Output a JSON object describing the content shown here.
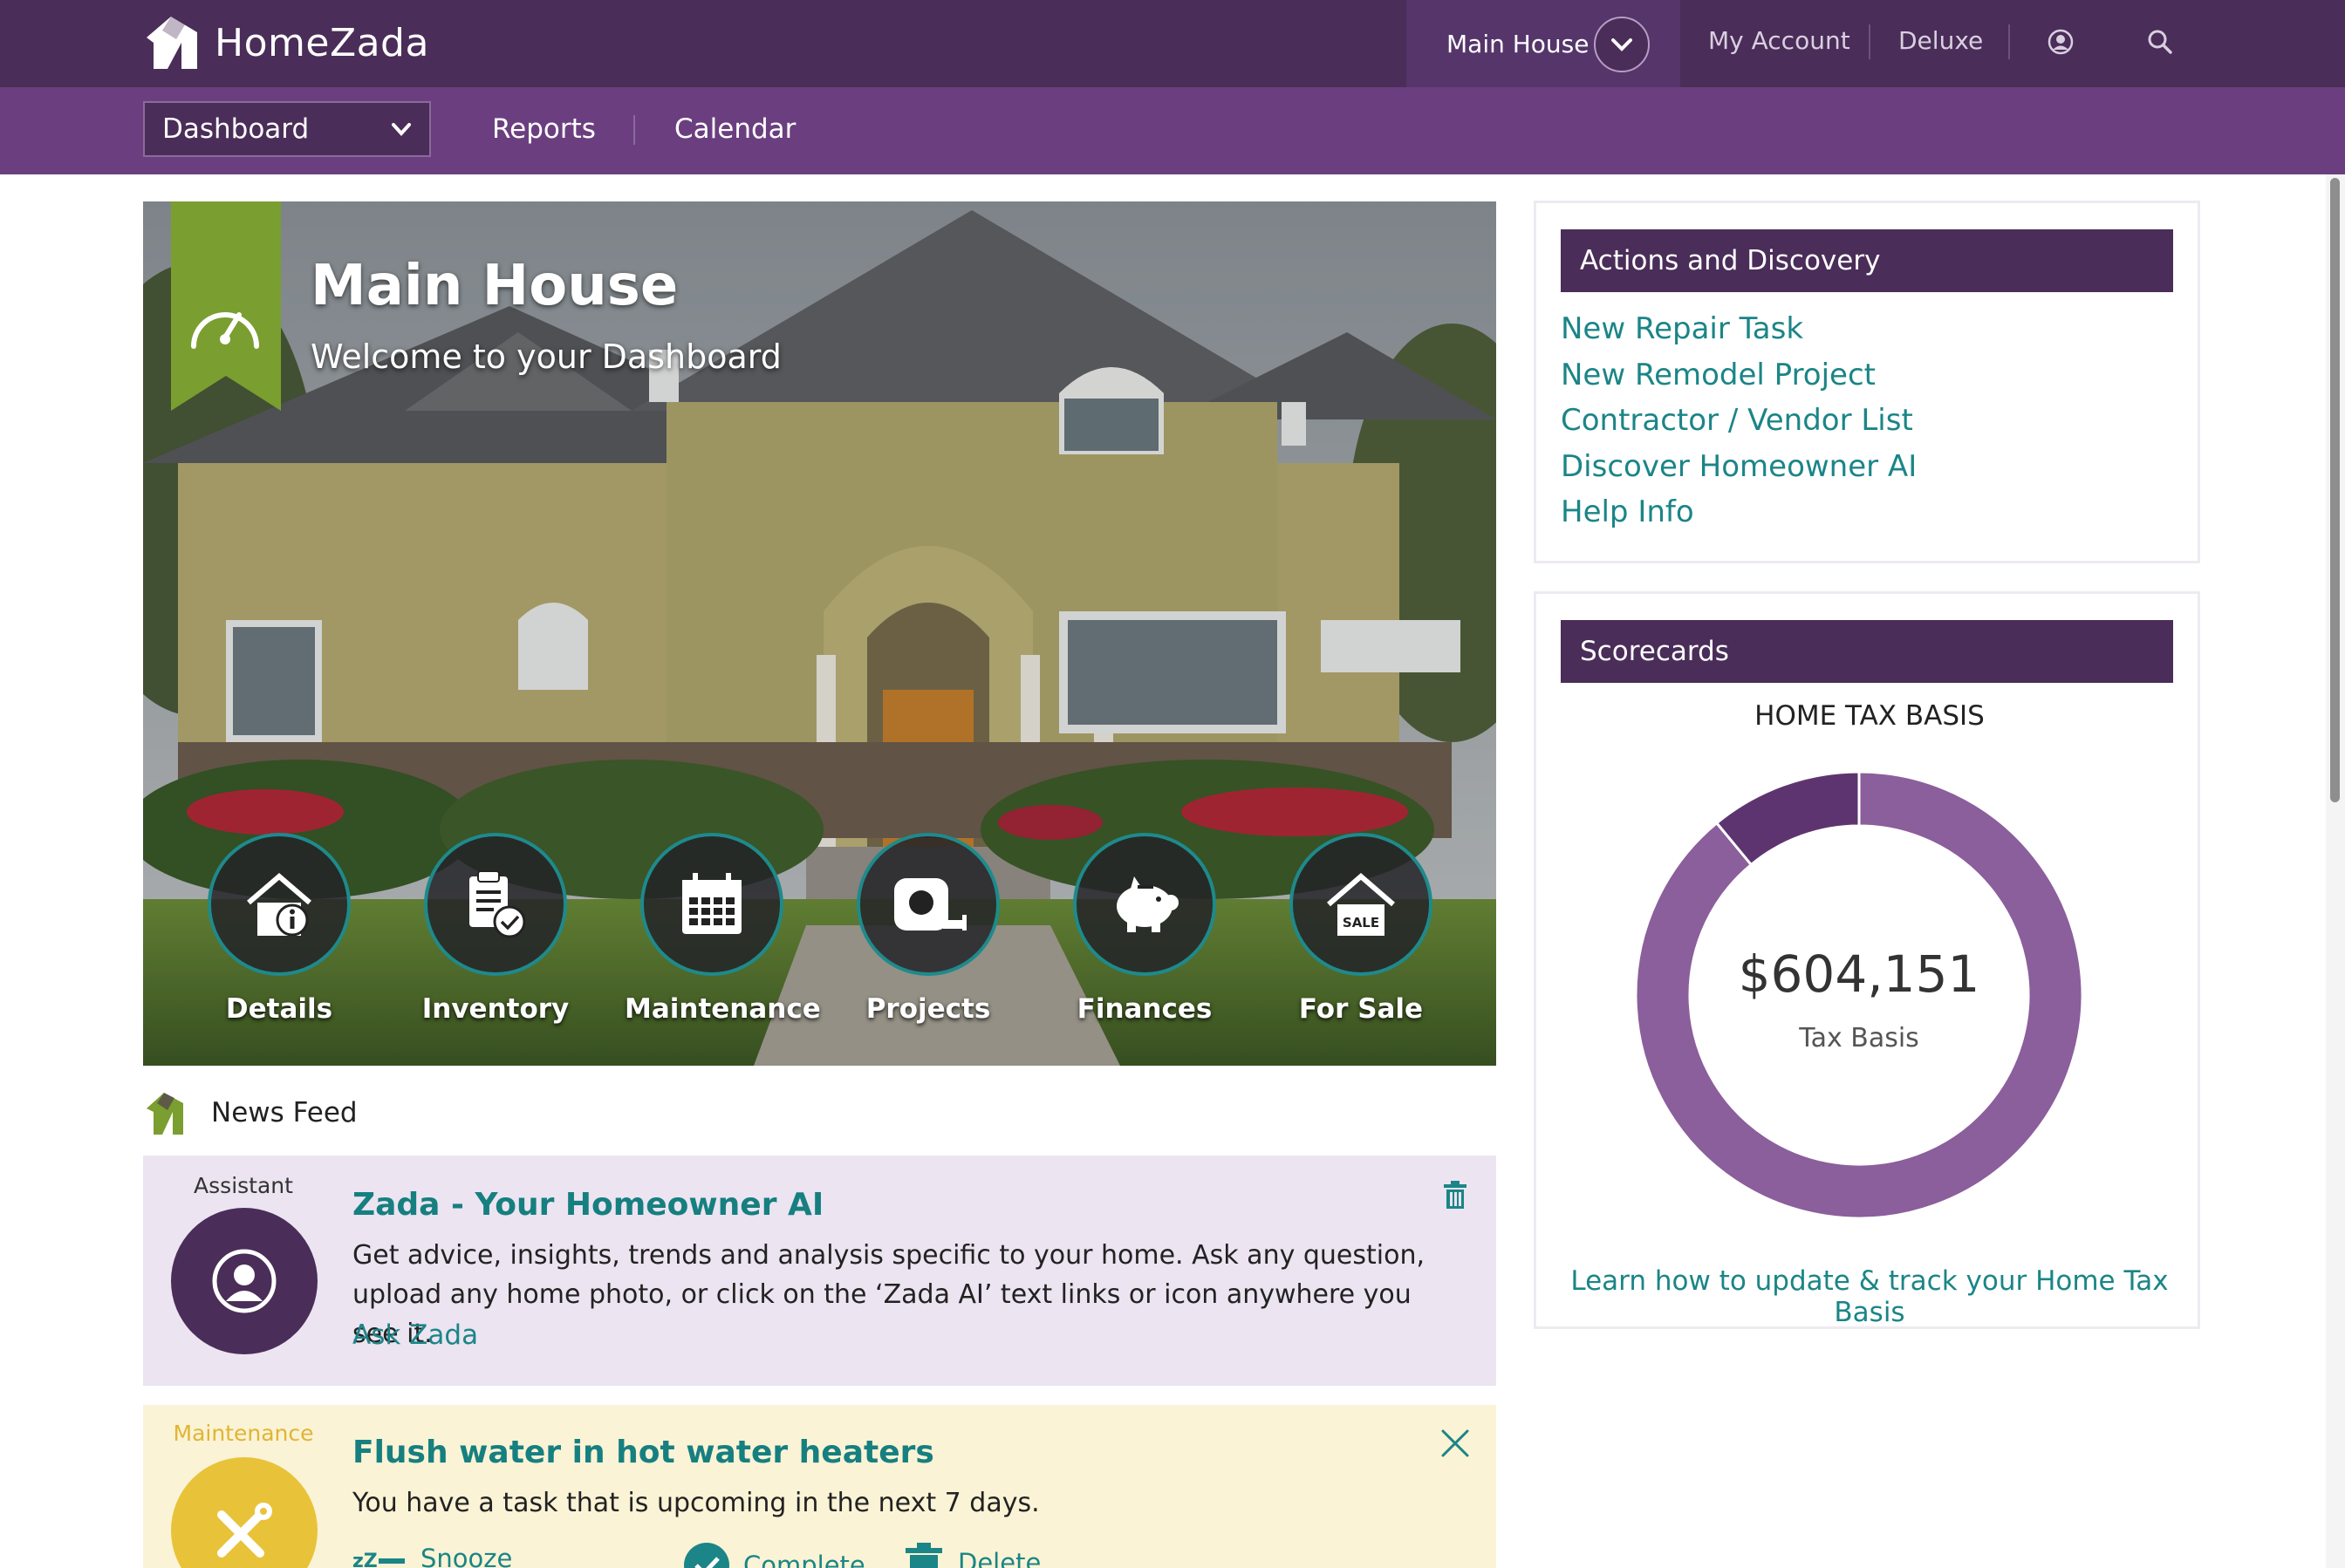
{
  "app": {
    "name": "HomeZada"
  },
  "topbar": {
    "property_name": "Main House",
    "my_account": "My Account",
    "plan": "Deluxe"
  },
  "subnav": {
    "dashboard_select": "Dashboard",
    "reports": "Reports",
    "calendar": "Calendar"
  },
  "hero": {
    "title": "Main House",
    "subtitle": "Welcome to your Dashboard",
    "tiles": [
      {
        "label": "Details",
        "icon": "house-info-icon"
      },
      {
        "label": "Inventory",
        "icon": "clipboard-check-icon"
      },
      {
        "label": "Maintenance",
        "icon": "calendar-icon"
      },
      {
        "label": "Projects",
        "icon": "tape-measure-icon"
      },
      {
        "label": "Finances",
        "icon": "piggy-bank-icon"
      },
      {
        "label": "For Sale",
        "icon": "house-sale-icon",
        "badge": "SALE"
      }
    ]
  },
  "news_feed": {
    "heading": "News Feed",
    "items": [
      {
        "category": "Assistant",
        "title": "Zada - Your Homeowner AI",
        "body": "Get advice, insights, trends and analysis specific to your home. Ask any question, upload any home photo, or click on the ‘Zada AI’ text links or icon anywhere you see it.",
        "link": "Ask Zada"
      },
      {
        "category": "Maintenance",
        "title": "Flush water in hot water heaters",
        "body": "You have a task that is upcoming in the next 7 days.",
        "actions": [
          "Snooze",
          "Complete",
          "Delete"
        ]
      }
    ]
  },
  "actions_panel": {
    "title": "Actions and Discovery",
    "links": [
      "New Repair Task",
      "New Remodel Project",
      "Contractor / Vendor List",
      "Discover Homeowner AI",
      "Help Info"
    ]
  },
  "scorecards": {
    "title": "Scorecards",
    "chart_title": "HOME TAX BASIS",
    "value": "$604,151",
    "value_label": "Tax Basis",
    "link": "Learn how to update & track your Home Tax Basis"
  },
  "chart_data": {
    "type": "pie",
    "variant": "donut",
    "slices": [
      {
        "value": 89,
        "color": "#8b5e9c"
      },
      {
        "value": 11,
        "color": "#5e3470"
      }
    ]
  },
  "colors": {
    "brand_dark": "#4a2d58",
    "brand_mid": "#6b3f7f",
    "link_teal": "#1b8587",
    "ribbon_green": "#7a9e2f",
    "maintenance_gold": "#e8c33a"
  }
}
